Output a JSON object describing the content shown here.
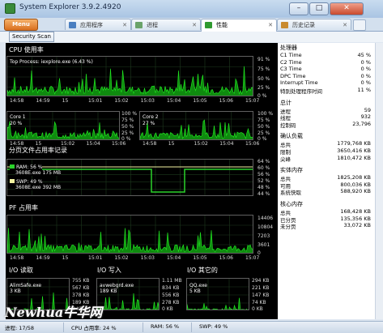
{
  "window": {
    "title": "System Explorer 3.9.2.4920",
    "min_label": "–",
    "max_label": "□",
    "close_label": "✕"
  },
  "menu": {
    "label": "Menu"
  },
  "tabs": [
    {
      "label": "应用程序",
      "active": false
    },
    {
      "label": "进程",
      "active": false
    },
    {
      "label": "性能",
      "active": true
    },
    {
      "label": "历史记录",
      "active": false
    }
  ],
  "toolbar": {
    "security_scan": "Security Scan"
  },
  "cpu": {
    "title": "CPU 使用率",
    "top_process": "Top Process: iexplore.exe (6.43 %)",
    "y_ticks": [
      "91 %",
      "75 %",
      "50 %",
      "25 %",
      "0 %"
    ],
    "x_ticks": [
      "14:58",
      "14:59",
      "15",
      "15:01",
      "15:02",
      "15:03",
      "15:04",
      "15:05",
      "15:06",
      "15:07"
    ],
    "cores": [
      {
        "label": "Core 1",
        "value": "20 %",
        "y_ticks": [
          "100 %",
          "75 %",
          "50 %",
          "25 %",
          "0 %"
        ]
      },
      {
        "label": "Core 2",
        "value": "27 %",
        "y_ticks": [
          "100 %",
          "75 %",
          "50 %",
          "25 %",
          "0 %"
        ]
      }
    ],
    "core_x_ticks": [
      "14:58",
      "15",
      "15:02",
      "15:04",
      "15:06"
    ]
  },
  "pagefile": {
    "title": "分页文件占用率记录",
    "ram_label": "RAM: 56 %",
    "ram_proc": "3608E.exe 175 MB",
    "swp_label": "SWP: 49 %",
    "swp_proc": "3608E.exe 392 MB",
    "y_ticks": [
      "64 %",
      "60 %",
      "56 %",
      "52 %",
      "48 %",
      "44 %"
    ]
  },
  "pf": {
    "title": "PF 占用率",
    "y_ticks": [
      "14406",
      "10804",
      "7203",
      "3601",
      "0"
    ],
    "x_ticks": [
      "14:58",
      "14:59",
      "15",
      "15:01",
      "15:02",
      "15:03",
      "15:04",
      "15:05",
      "15:06",
      "15:07"
    ]
  },
  "io": {
    "read": {
      "title": "I/O 读取",
      "proc": "AlimSafe.exe",
      "proc_val": "3 KB",
      "y_ticks": [
        "755 KB",
        "567 KB",
        "378 KB",
        "189 KB",
        "0 KB"
      ]
    },
    "write": {
      "title": "I/O 写入",
      "proc": "avwebgrd.exe",
      "proc_val": "189 KB",
      "y_ticks": [
        "1.11 MB",
        "834 KB",
        "556 KB",
        "278 KB",
        "0 KB"
      ]
    },
    "other": {
      "title": "I/O 其它的",
      "proc": "QQ.exe",
      "proc_val": "5 KB",
      "y_ticks": [
        "294 KB",
        "221 KB",
        "147 KB",
        "74 KB",
        "0 KB"
      ]
    }
  },
  "stats": {
    "processor": {
      "title": "处理器",
      "rows": [
        {
          "k": "C1 Time",
          "v": "45 %"
        },
        {
          "k": "C2 Time",
          "v": "0 %"
        },
        {
          "k": "C3 Time",
          "v": "0 %"
        },
        {
          "k": "DPC Time",
          "v": "0 %"
        },
        {
          "k": "Interrupt Time",
          "v": "0 %"
        },
        {
          "k": "特别处理程序时间",
          "v": "11 %"
        }
      ]
    },
    "totals": {
      "title": "总计",
      "rows": [
        {
          "k": "进程",
          "v": "59"
        },
        {
          "k": "线程",
          "v": "932"
        },
        {
          "k": "控制码",
          "v": "23,796"
        }
      ]
    },
    "commit": {
      "title": "确认负载",
      "rows": [
        {
          "k": "总共",
          "v": "1779,768 KB"
        },
        {
          "k": "限制",
          "v": "3650,416 KB"
        },
        {
          "k": "尖峰",
          "v": "1810,472 KB"
        }
      ]
    },
    "physical": {
      "title": "实体内存",
      "rows": [
        {
          "k": "总共",
          "v": "1825,208 KB"
        },
        {
          "k": "可用",
          "v": "800,036 KB"
        },
        {
          "k": "系统快取",
          "v": "588,920 KB"
        }
      ]
    },
    "kernel": {
      "title": "核心内存",
      "rows": [
        {
          "k": "总共",
          "v": "168,428 KB"
        },
        {
          "k": "已分页",
          "v": "135,356 KB"
        },
        {
          "k": "未分页",
          "v": "33,072 KB"
        }
      ]
    }
  },
  "statusbar": {
    "processes": "进程: 17/58",
    "cpu": "CPU 占用率: 24 %",
    "ram": "RAM: 56 %",
    "swp": "SWP: 49 %"
  },
  "watermark": "Newhua牛华网",
  "colors": {
    "graph_bg": "#000000",
    "graph_line": "#1fe11f",
    "graph_fill": "#0f8a0f",
    "grid": "#2f4f2f",
    "accent": "#e8872a"
  }
}
